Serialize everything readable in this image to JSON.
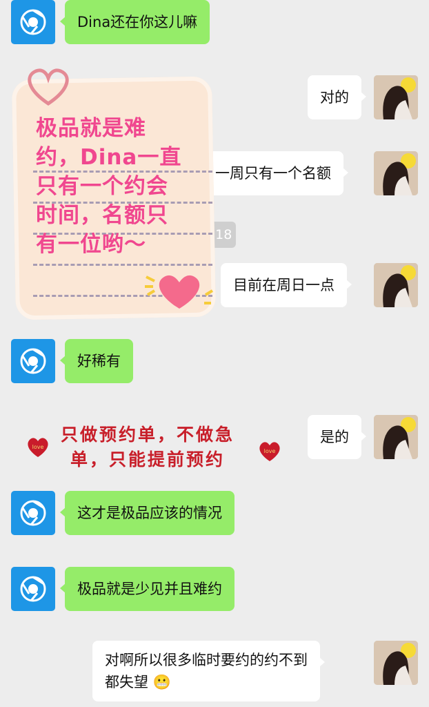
{
  "messages": [
    {
      "side": "left",
      "text": "Dina还在你这儿嘛"
    },
    {
      "side": "right",
      "text": "对的"
    },
    {
      "side": "right",
      "text": "一周只有一个名额"
    },
    {
      "side": "right",
      "text": "目前在周日一点"
    },
    {
      "side": "left",
      "text": "好稀有"
    },
    {
      "side": "right",
      "text": "是的"
    },
    {
      "side": "left",
      "text": "这才是极品应该的情况"
    },
    {
      "side": "left",
      "text": "极品就是少见并且难约"
    },
    {
      "side": "right",
      "text_line1": "对啊所以很多临时要约的约不到",
      "text_line2": "都失望",
      "emoji": "😬"
    }
  ],
  "timestamp_fragment": ":18",
  "sticker_notes": {
    "pink_note": "极品就是难\n约，Dina一直\n只有一个约会\n时间，名额只\n有一位哟～",
    "red_banner_line1": "只做预约单，不做急",
    "red_banner_line2": "单，只能提前预约",
    "love_badge": "love"
  },
  "colors": {
    "background": "#ededed",
    "sent_bubble": "#95ec69",
    "received_bubble": "#ffffff",
    "left_avatar": "#1e96e6",
    "pink_text": "#f0478f",
    "red_text": "#c81f2a"
  },
  "icons": {
    "left_avatar": "chrome-like-circle-icon",
    "right_avatar": "girl-photo-avatar"
  }
}
